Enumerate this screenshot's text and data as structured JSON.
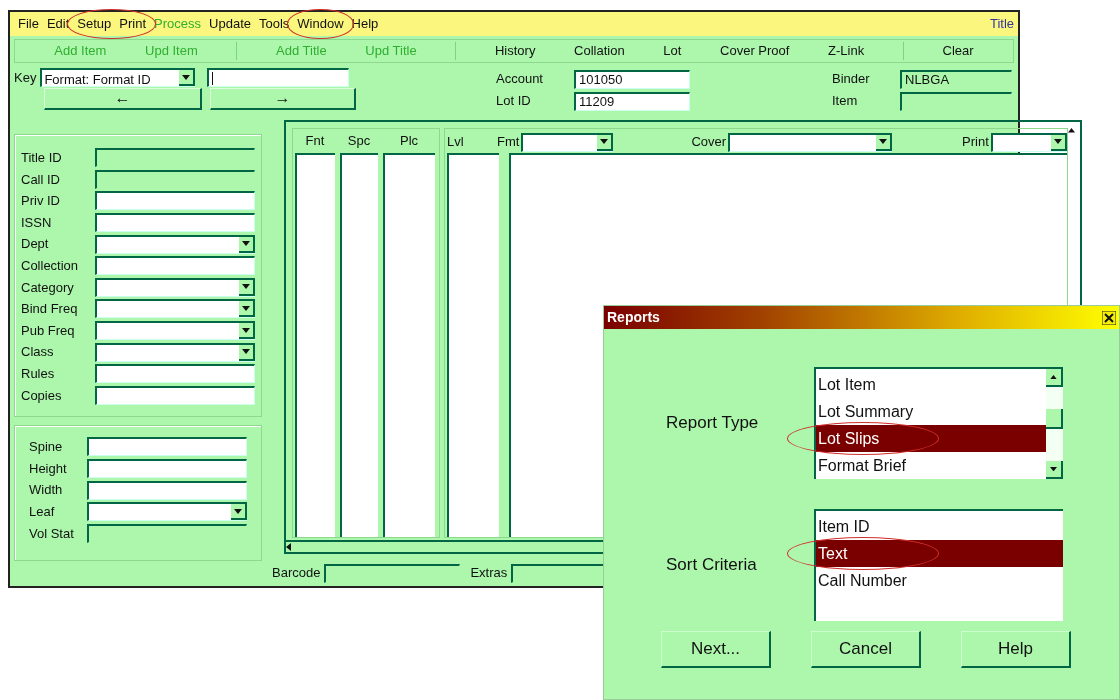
{
  "main_window": {
    "title": "Title",
    "menu": [
      {
        "label": "File",
        "disabled": false,
        "circled": false
      },
      {
        "label": "Edit",
        "disabled": false,
        "circled": false
      },
      {
        "label": "Setup",
        "disabled": false,
        "circled": true
      },
      {
        "label": "Print",
        "disabled": false,
        "circled": true
      },
      {
        "label": "Process",
        "disabled": true,
        "circled": false
      },
      {
        "label": "Update",
        "disabled": false,
        "circled": false
      },
      {
        "label": "Tools",
        "disabled": false,
        "circled": false
      },
      {
        "label": "Window",
        "disabled": false,
        "circled": true
      },
      {
        "label": "Help",
        "disabled": false,
        "circled": false
      }
    ],
    "toolbar": [
      {
        "label": "Add Item",
        "disabled": true,
        "separator_after": false
      },
      {
        "label": "Upd Item",
        "disabled": true,
        "separator_after": true
      },
      {
        "label": "Add Title",
        "disabled": true,
        "separator_after": false
      },
      {
        "label": "Upd Title",
        "disabled": true,
        "separator_after": true
      },
      {
        "label": "History",
        "disabled": false,
        "separator_after": false
      },
      {
        "label": "Collation",
        "disabled": false,
        "separator_after": false
      },
      {
        "label": "Lot",
        "disabled": false,
        "separator_after": false
      },
      {
        "label": "Cover Proof",
        "disabled": false,
        "separator_after": false
      },
      {
        "label": "Z-Link",
        "disabled": false,
        "separator_after": true
      },
      {
        "label": "Clear",
        "disabled": false,
        "separator_after": false
      }
    ],
    "key": {
      "label": "Key",
      "value": "Format: Format ID",
      "back": "←",
      "forward": "→"
    },
    "header_fields": [
      {
        "label": "Account",
        "value": "101050",
        "kind": "input"
      },
      {
        "label": "Lot ID",
        "value": "11209",
        "kind": "input"
      },
      {
        "label": "Binder",
        "value": "NLBGA",
        "kind": "display"
      },
      {
        "label": "Item",
        "kind": "display"
      }
    ],
    "title_fields": [
      {
        "label": "Title ID",
        "kind": "display"
      },
      {
        "label": "Call ID",
        "kind": "display"
      },
      {
        "label": "Priv ID",
        "kind": "input"
      },
      {
        "label": "ISSN",
        "kind": "input"
      },
      {
        "label": "Dept",
        "kind": "dropdown"
      },
      {
        "label": "Collection",
        "kind": "input"
      },
      {
        "label": "Category",
        "kind": "dropdown"
      },
      {
        "label": "Bind Freq",
        "kind": "dropdown"
      },
      {
        "label": "Pub Freq",
        "kind": "dropdown"
      },
      {
        "label": "Class",
        "kind": "dropdown"
      },
      {
        "label": "Rules",
        "kind": "input"
      },
      {
        "label": "Copies",
        "kind": "input"
      }
    ],
    "size_fields": [
      {
        "label": "Spine",
        "kind": "input"
      },
      {
        "label": "Height",
        "kind": "input"
      },
      {
        "label": "Width",
        "kind": "input"
      },
      {
        "label": "Leaf",
        "kind": "dropdown"
      },
      {
        "label": "Vol Stat",
        "kind": "display"
      }
    ],
    "grid": {
      "left_columns": [
        "Fnt",
        "Spc",
        "Plc"
      ],
      "right_columns": [
        {
          "label": "Lvl",
          "kind": "plain"
        },
        {
          "label": "Fmt",
          "kind": "dropdown"
        },
        {
          "label": "Cover",
          "kind": "dropdown"
        },
        {
          "label": "Print",
          "kind": "dropdown"
        }
      ]
    },
    "footer_fields": [
      {
        "label": "Barcode",
        "kind": "display"
      },
      {
        "label": "Extras",
        "kind": "display"
      }
    ]
  },
  "dialog": {
    "title": "Reports",
    "lists": [
      {
        "label": "Report Type",
        "scrollbar": true,
        "items": [
          {
            "text": "Lot Item",
            "selected": false,
            "circled": false
          },
          {
            "text": "Lot Summary",
            "selected": false,
            "circled": false
          },
          {
            "text": "Lot Slips",
            "selected": true,
            "circled": true
          },
          {
            "text": "Format Brief",
            "selected": false,
            "circled": false
          }
        ]
      },
      {
        "label": "Sort Criteria",
        "scrollbar": false,
        "items": [
          {
            "text": "Item ID",
            "selected": false,
            "circled": false
          },
          {
            "text": "Text",
            "selected": true,
            "circled": true
          },
          {
            "text": "Call Number",
            "selected": false,
            "circled": false
          }
        ]
      }
    ],
    "buttons": [
      "Next...",
      "Cancel",
      "Help"
    ]
  }
}
